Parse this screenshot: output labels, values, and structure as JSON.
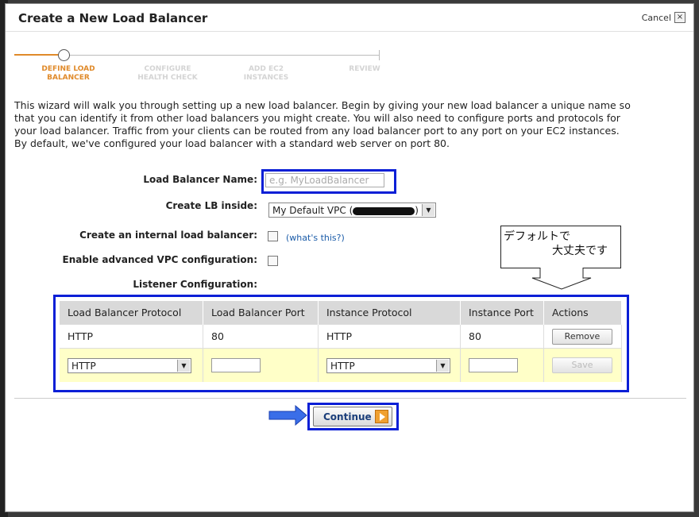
{
  "dialog": {
    "title": "Create a New Load Balancer",
    "cancel_label": "Cancel",
    "close_glyph": "×"
  },
  "steps": [
    {
      "line1": "DEFINE LOAD",
      "line2": "BALANCER",
      "state": "active"
    },
    {
      "line1": "CONFIGURE",
      "line2": "HEALTH CHECK",
      "state": "inactive"
    },
    {
      "line1": "ADD EC2",
      "line2": "INSTANCES",
      "state": "inactive"
    },
    {
      "line1": "REVIEW",
      "line2": "",
      "state": "inactive"
    }
  ],
  "intro": {
    "line1": "This wizard will walk you through setting up a new load balancer. Begin by giving your new load balancer a unique name so",
    "line2": "that you can identify it from other load balancers you might create. You will also need to configure ports and protocols for",
    "line3": "your load balancer. Traffic from your clients can be routed from any load balancer port to any port on your EC2 instances.",
    "line4": "By default, we've configured your load balancer with a standard web server on port 80."
  },
  "form": {
    "name_label": "Load Balancer Name:",
    "name_placeholder": "e.g. MyLoadBalancer",
    "vpc_label": "Create LB inside:",
    "vpc_value_prefix": "My Default VPC (",
    "vpc_value_suffix": ")",
    "internal_label": "Create an internal load balancer:",
    "whats_this": "(what's this?)",
    "advanced_label": "Enable advanced VPC configuration:",
    "listener_label": "Listener Configuration:"
  },
  "callout": {
    "line1": "デフォルトで",
    "line2": "大丈夫です"
  },
  "listener_table": {
    "headers": [
      "Load Balancer Protocol",
      "Load Balancer Port",
      "Instance Protocol",
      "Instance Port",
      "Actions"
    ],
    "rows": [
      {
        "lb_protocol": "HTTP",
        "lb_port": "80",
        "instance_protocol": "HTTP",
        "instance_port": "80",
        "action": "Remove"
      }
    ],
    "new_row": {
      "lb_protocol": "HTTP",
      "instance_protocol": "HTTP",
      "action": "Save"
    }
  },
  "footer": {
    "continue_label": "Continue"
  },
  "colors": {
    "highlight_box": "#0a1fd6",
    "arrow": "#3a6ee8",
    "active_step": "#e08a2a"
  },
  "icons": {
    "select_arrow": "▼"
  }
}
